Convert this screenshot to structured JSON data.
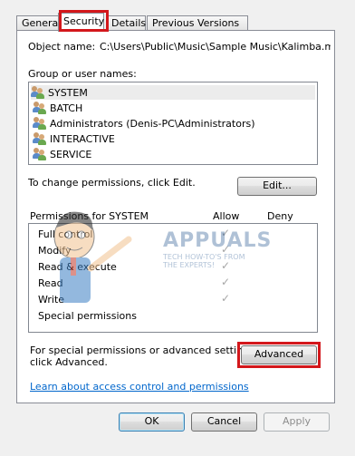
{
  "tabs": [
    {
      "label": "General"
    },
    {
      "label": "Security",
      "selected": true
    },
    {
      "label": "Details"
    },
    {
      "label": "Previous Versions"
    }
  ],
  "object": {
    "label": "Object name:",
    "value": "C:\\Users\\Public\\Music\\Sample Music\\Kalimba.mp"
  },
  "groups": {
    "label": "Group or user names:",
    "items": [
      {
        "name": "SYSTEM",
        "icon": "user-group-icon"
      },
      {
        "name": "BATCH",
        "icon": "user-group-icon"
      },
      {
        "name": "Administrators (Denis-PC\\Administrators)",
        "icon": "user-group-icon"
      },
      {
        "name": "INTERACTIVE",
        "icon": "user-group-icon"
      },
      {
        "name": "SERVICE",
        "icon": "user-group-icon"
      }
    ]
  },
  "change_text": "To change permissions, click Edit.",
  "edit_button": "Edit...",
  "permissions": {
    "header": "Permissions for SYSTEM",
    "allow": "Allow",
    "deny": "Deny",
    "rows": [
      {
        "name": "Full control",
        "allow": true
      },
      {
        "name": "Modify",
        "allow": true
      },
      {
        "name": "Read & execute",
        "allow": true
      },
      {
        "name": "Read",
        "allow": true
      },
      {
        "name": "Write",
        "allow": true
      },
      {
        "name": "Special permissions",
        "allow": false
      }
    ]
  },
  "advanced": {
    "text_line1": "For special permissions or advanced settings,",
    "text_line2": "click Advanced.",
    "button": "Advanced"
  },
  "learn_link": "Learn about access control and permissions",
  "footer": {
    "ok": "OK",
    "cancel": "Cancel",
    "apply": "Apply"
  },
  "watermark": {
    "brand": "APPUALS",
    "tagline_1": "TECH HOW-TO'S FROM",
    "tagline_2": "THE EXPERTS!"
  },
  "colors": {
    "highlight_box": "#d3171b",
    "link": "#0066cc"
  }
}
